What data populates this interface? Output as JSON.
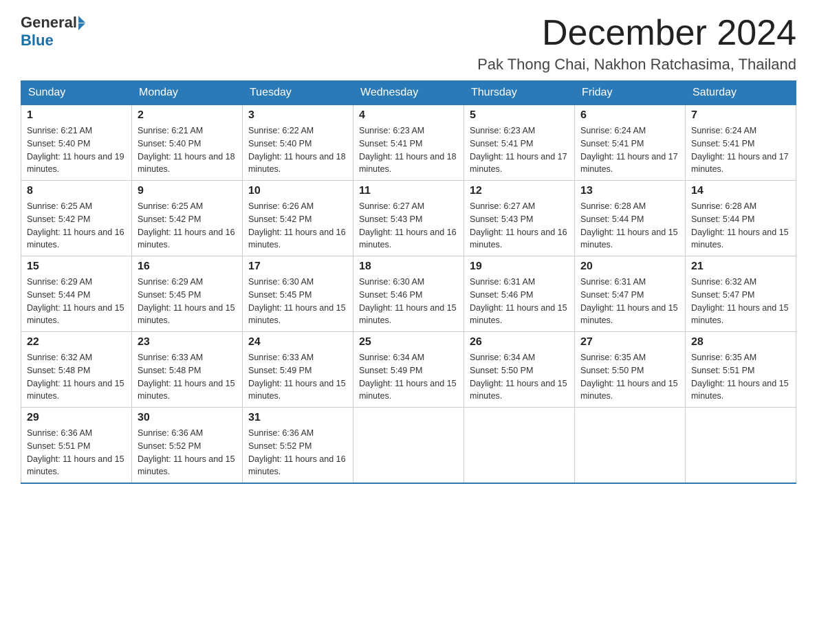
{
  "header": {
    "logo_general": "General",
    "logo_blue": "Blue",
    "month_title": "December 2024",
    "location": "Pak Thong Chai, Nakhon Ratchasima, Thailand"
  },
  "days_of_week": [
    "Sunday",
    "Monday",
    "Tuesday",
    "Wednesday",
    "Thursday",
    "Friday",
    "Saturday"
  ],
  "weeks": [
    [
      {
        "day": "1",
        "sunrise": "6:21 AM",
        "sunset": "5:40 PM",
        "daylight": "11 hours and 19 minutes."
      },
      {
        "day": "2",
        "sunrise": "6:21 AM",
        "sunset": "5:40 PM",
        "daylight": "11 hours and 18 minutes."
      },
      {
        "day": "3",
        "sunrise": "6:22 AM",
        "sunset": "5:40 PM",
        "daylight": "11 hours and 18 minutes."
      },
      {
        "day": "4",
        "sunrise": "6:23 AM",
        "sunset": "5:41 PM",
        "daylight": "11 hours and 18 minutes."
      },
      {
        "day": "5",
        "sunrise": "6:23 AM",
        "sunset": "5:41 PM",
        "daylight": "11 hours and 17 minutes."
      },
      {
        "day": "6",
        "sunrise": "6:24 AM",
        "sunset": "5:41 PM",
        "daylight": "11 hours and 17 minutes."
      },
      {
        "day": "7",
        "sunrise": "6:24 AM",
        "sunset": "5:41 PM",
        "daylight": "11 hours and 17 minutes."
      }
    ],
    [
      {
        "day": "8",
        "sunrise": "6:25 AM",
        "sunset": "5:42 PM",
        "daylight": "11 hours and 16 minutes."
      },
      {
        "day": "9",
        "sunrise": "6:25 AM",
        "sunset": "5:42 PM",
        "daylight": "11 hours and 16 minutes."
      },
      {
        "day": "10",
        "sunrise": "6:26 AM",
        "sunset": "5:42 PM",
        "daylight": "11 hours and 16 minutes."
      },
      {
        "day": "11",
        "sunrise": "6:27 AM",
        "sunset": "5:43 PM",
        "daylight": "11 hours and 16 minutes."
      },
      {
        "day": "12",
        "sunrise": "6:27 AM",
        "sunset": "5:43 PM",
        "daylight": "11 hours and 16 minutes."
      },
      {
        "day": "13",
        "sunrise": "6:28 AM",
        "sunset": "5:44 PM",
        "daylight": "11 hours and 15 minutes."
      },
      {
        "day": "14",
        "sunrise": "6:28 AM",
        "sunset": "5:44 PM",
        "daylight": "11 hours and 15 minutes."
      }
    ],
    [
      {
        "day": "15",
        "sunrise": "6:29 AM",
        "sunset": "5:44 PM",
        "daylight": "11 hours and 15 minutes."
      },
      {
        "day": "16",
        "sunrise": "6:29 AM",
        "sunset": "5:45 PM",
        "daylight": "11 hours and 15 minutes."
      },
      {
        "day": "17",
        "sunrise": "6:30 AM",
        "sunset": "5:45 PM",
        "daylight": "11 hours and 15 minutes."
      },
      {
        "day": "18",
        "sunrise": "6:30 AM",
        "sunset": "5:46 PM",
        "daylight": "11 hours and 15 minutes."
      },
      {
        "day": "19",
        "sunrise": "6:31 AM",
        "sunset": "5:46 PM",
        "daylight": "11 hours and 15 minutes."
      },
      {
        "day": "20",
        "sunrise": "6:31 AM",
        "sunset": "5:47 PM",
        "daylight": "11 hours and 15 minutes."
      },
      {
        "day": "21",
        "sunrise": "6:32 AM",
        "sunset": "5:47 PM",
        "daylight": "11 hours and 15 minutes."
      }
    ],
    [
      {
        "day": "22",
        "sunrise": "6:32 AM",
        "sunset": "5:48 PM",
        "daylight": "11 hours and 15 minutes."
      },
      {
        "day": "23",
        "sunrise": "6:33 AM",
        "sunset": "5:48 PM",
        "daylight": "11 hours and 15 minutes."
      },
      {
        "day": "24",
        "sunrise": "6:33 AM",
        "sunset": "5:49 PM",
        "daylight": "11 hours and 15 minutes."
      },
      {
        "day": "25",
        "sunrise": "6:34 AM",
        "sunset": "5:49 PM",
        "daylight": "11 hours and 15 minutes."
      },
      {
        "day": "26",
        "sunrise": "6:34 AM",
        "sunset": "5:50 PM",
        "daylight": "11 hours and 15 minutes."
      },
      {
        "day": "27",
        "sunrise": "6:35 AM",
        "sunset": "5:50 PM",
        "daylight": "11 hours and 15 minutes."
      },
      {
        "day": "28",
        "sunrise": "6:35 AM",
        "sunset": "5:51 PM",
        "daylight": "11 hours and 15 minutes."
      }
    ],
    [
      {
        "day": "29",
        "sunrise": "6:36 AM",
        "sunset": "5:51 PM",
        "daylight": "11 hours and 15 minutes."
      },
      {
        "day": "30",
        "sunrise": "6:36 AM",
        "sunset": "5:52 PM",
        "daylight": "11 hours and 15 minutes."
      },
      {
        "day": "31",
        "sunrise": "6:36 AM",
        "sunset": "5:52 PM",
        "daylight": "11 hours and 16 minutes."
      },
      null,
      null,
      null,
      null
    ]
  ]
}
